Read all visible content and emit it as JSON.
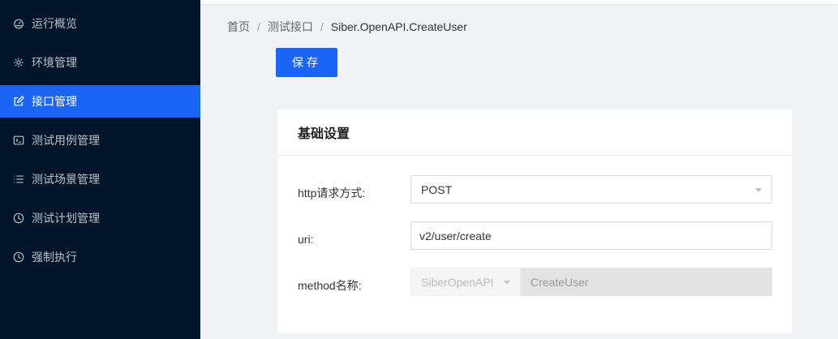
{
  "sidebar": {
    "items": [
      {
        "label": "运行概览",
        "icon": "dashboard-icon"
      },
      {
        "label": "环境管理",
        "icon": "gear-icon"
      },
      {
        "label": "接口管理",
        "icon": "edit-icon",
        "active": true
      },
      {
        "label": "测试用例管理",
        "icon": "terminal-icon"
      },
      {
        "label": "测试场景管理",
        "icon": "list-icon"
      },
      {
        "label": "测试计划管理",
        "icon": "clock-icon"
      },
      {
        "label": "强制执行",
        "icon": "clock-icon"
      }
    ],
    "active_color": "#1b65f5",
    "background": "#001529"
  },
  "breadcrumb": {
    "items": [
      "首页",
      "测试接口",
      "Siber.OpenAPI.CreateUser"
    ],
    "separator": "/"
  },
  "toolbar": {
    "save_label": "保存"
  },
  "card": {
    "title": "基础设置",
    "fields": {
      "http_method": {
        "label": "http请求方式:",
        "value": "POST"
      },
      "uri": {
        "label": "uri:",
        "value": "v2/user/create"
      },
      "method_name": {
        "label": "method名称:",
        "service": "SiberOpenAPI",
        "method": "CreateUser",
        "disabled": true
      }
    }
  }
}
